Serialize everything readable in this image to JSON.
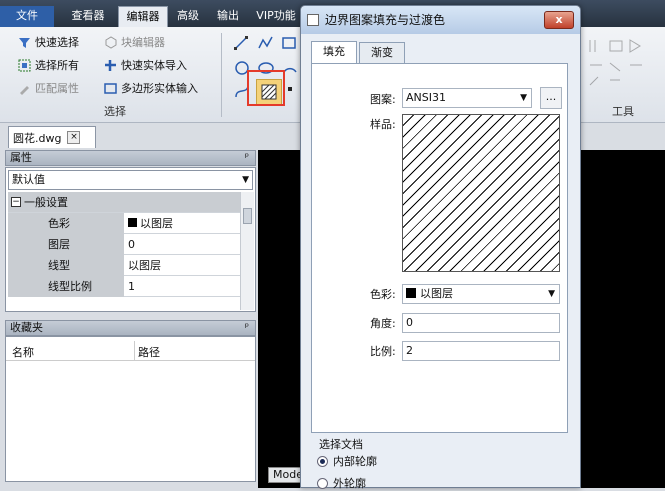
{
  "menu": {
    "tabs": [
      "文件",
      "查看器",
      "编辑器",
      "高级",
      "输出",
      "VIP功能"
    ]
  },
  "ribbon": {
    "select_buttons": [
      "快速选择",
      "选择所有",
      "匹配属性"
    ],
    "edit_buttons": [
      "块编辑器",
      "快速实体导入",
      "多边形实体输入"
    ],
    "group_label": "选择",
    "tools_label": "工具"
  },
  "document": {
    "tab_name": "圆花.dwg",
    "close": "×"
  },
  "properties": {
    "title": "属性",
    "pin": "ᵖ",
    "dropdown": "默认值",
    "section": "一般设置",
    "rows": [
      {
        "key": "色彩",
        "value": "以图层"
      },
      {
        "key": "图层",
        "value": "0"
      },
      {
        "key": "线型",
        "value": "以图层"
      },
      {
        "key": "线型比例",
        "value": "1"
      }
    ]
  },
  "favorites": {
    "title": "收藏夹",
    "pin": "ᵖ",
    "col_name": "名称",
    "col_path": "路径"
  },
  "model_tab": "Mode",
  "dialog": {
    "title": "边界图案填充与过渡色",
    "close": "x",
    "tabs": [
      "填充",
      "渐变"
    ],
    "pattern_label": "图案:",
    "pattern_value": "ANSI31",
    "browse": "...",
    "sample_label": "样品:",
    "color_label": "色彩:",
    "color_value": "以图层",
    "angle_label": "角度:",
    "angle_value": "0",
    "scale_label": "比例:",
    "scale_value": "2",
    "select_group": "选择文档",
    "radio_inner": "内部轮廓",
    "radio_outer": "外轮廓"
  },
  "colors": {
    "menubar": "#2f3b4b",
    "highlight": "#e43a2a",
    "canvas": "#000000"
  }
}
